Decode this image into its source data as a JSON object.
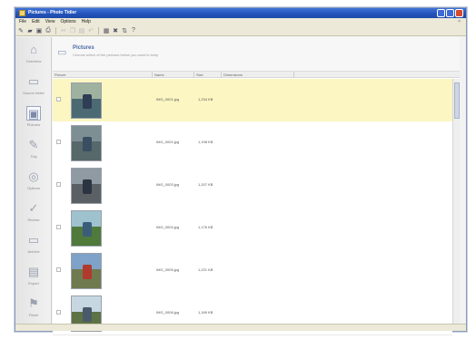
{
  "window": {
    "title": "Pictures - Photo Tidier"
  },
  "menu": [
    "File",
    "Edit",
    "View",
    "Options",
    "Help"
  ],
  "toolbar": {
    "buttons": [
      {
        "icon": "new-icon",
        "glyph": "✎"
      },
      {
        "icon": "open-icon",
        "glyph": "▰"
      },
      {
        "icon": "save-icon",
        "glyph": "▣"
      },
      {
        "icon": "print-icon",
        "glyph": "⎙"
      },
      {
        "icon": "cut-icon",
        "glyph": "✂"
      },
      {
        "icon": "copy-icon",
        "glyph": "❐"
      },
      {
        "icon": "paste-icon",
        "glyph": "▤"
      },
      {
        "icon": "undo-icon",
        "glyph": "↶"
      },
      {
        "icon": "grid-icon",
        "glyph": "▦"
      },
      {
        "icon": "delete-icon",
        "glyph": "✖"
      },
      {
        "icon": "sort-icon",
        "glyph": "⇅"
      },
      {
        "icon": "help-icon",
        "glyph": "?"
      }
    ]
  },
  "sidebar": {
    "items": [
      {
        "icon": "home-icon",
        "glyph": "⌂",
        "label": "Overview"
      },
      {
        "icon": "folder-icon",
        "glyph": "▭",
        "label": "Source folder"
      },
      {
        "icon": "pictures-icon",
        "glyph": "▣",
        "label": "Pictures"
      },
      {
        "icon": "tools-icon",
        "glyph": "✎",
        "label": "Tidy"
      },
      {
        "icon": "settings-icon",
        "glyph": "◎",
        "label": "Options"
      },
      {
        "icon": "check-icon",
        "glyph": "✓",
        "label": "Review"
      },
      {
        "icon": "archive-icon",
        "glyph": "▭",
        "label": "Archive"
      },
      {
        "icon": "export-icon",
        "glyph": "▤",
        "label": "Export"
      },
      {
        "icon": "finish-icon",
        "glyph": "⚑",
        "label": "Finish"
      }
    ]
  },
  "header": {
    "title": "Pictures",
    "subtitle": "Choose which of the pictures below you want to keep"
  },
  "columns": [
    "Picture",
    "Name",
    "Size",
    "Dimensions"
  ],
  "rows": [
    {
      "name": "IMG_0001.jpg",
      "size": "1,234 KB",
      "selected": true,
      "sky": "#9fb2a0",
      "ground": "#4c6a74",
      "fig": "#2f3d55"
    },
    {
      "name": "IMG_0002.jpg",
      "size": "1,198 KB",
      "selected": false,
      "sky": "#7d8f93",
      "ground": "#56686a",
      "fig": "#3a4e62"
    },
    {
      "name": "IMG_0003.jpg",
      "size": "1,207 KB",
      "selected": false,
      "sky": "#8f9aa3",
      "ground": "#5b6064",
      "fig": "#2b3440"
    },
    {
      "name": "IMG_0004.jpg",
      "size": "1,176 KB",
      "selected": false,
      "sky": "#9ec3cf",
      "ground": "#4f7a3c",
      "fig": "#3c5d7a"
    },
    {
      "name": "IMG_0005.jpg",
      "size": "1,221 KB",
      "selected": false,
      "sky": "#7fa2c8",
      "ground": "#6f7a4f",
      "fig": "#b03a2e"
    },
    {
      "name": "IMG_0006.jpg",
      "size": "1,189 KB",
      "selected": false,
      "sky": "#c6d7e2",
      "ground": "#5d7346",
      "fig": "#4b5a6a"
    }
  ]
}
